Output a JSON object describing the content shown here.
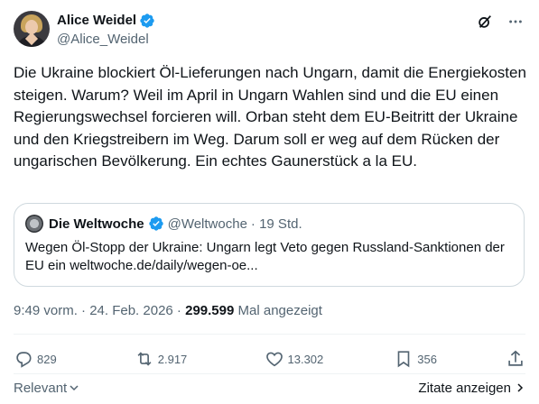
{
  "author": {
    "name": "Alice Weidel",
    "handle": "@Alice_Weidel",
    "verified": true,
    "verified_color": "#1d9bf0"
  },
  "header_icons": [
    "grok-icon",
    "more-icon"
  ],
  "tweet": {
    "text": "Die Ukraine blockiert Öl-Lieferungen nach Ungarn, damit die Energiekosten steigen. Warum? Weil im April in Ungarn Wahlen sind und die EU einen Regierungswechsel forcieren will. Orban steht dem EU-Beitritt der Ukraine und den Kriegstreibern im Weg. Darum soll er weg auf dem Rücken der ungarischen Bevölkerung. Ein echtes Gaunerstück a la EU."
  },
  "quote": {
    "name": "Die Weltwoche",
    "handle": "@Weltwoche",
    "time": "· 19 Std.",
    "verified": true,
    "text": "Wegen Öl-Stopp der Ukraine: Ungarn legt Veto gegen Russland-Sanktionen der EU ein weltwoche.de/daily/wegen-oe..."
  },
  "meta": {
    "timestamp": "9:49 vorm. · 24. Feb. 2026 ·",
    "views": "299.599",
    "views_label": "Mal angezeigt"
  },
  "actions": {
    "replies": "829",
    "reposts": "2.917",
    "likes": "13.302",
    "bookmarks": "356"
  },
  "footer": {
    "sort_label": "Relevant",
    "quotes_label": "Zitate anzeigen"
  }
}
